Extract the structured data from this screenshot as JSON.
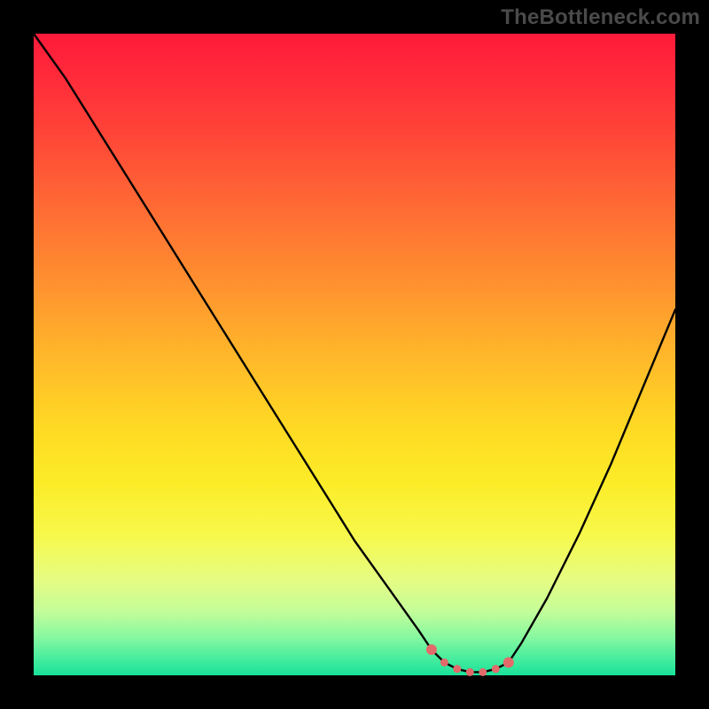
{
  "watermark": "TheBottleneck.com",
  "chart_data": {
    "type": "line",
    "title": "",
    "xlabel": "",
    "ylabel": "",
    "xlim": [
      0,
      100
    ],
    "ylim": [
      0,
      100
    ],
    "grid": false,
    "legend": false,
    "series": [
      {
        "name": "curve",
        "x": [
          0,
          5,
          10,
          15,
          20,
          25,
          30,
          35,
          40,
          45,
          50,
          55,
          60,
          62,
          64,
          66,
          68,
          70,
          72,
          74,
          76,
          80,
          85,
          90,
          95,
          100
        ],
        "y": [
          100,
          93,
          85,
          77,
          69,
          61,
          53,
          45,
          37,
          29,
          21,
          14,
          7,
          4,
          2,
          1,
          0.5,
          0.5,
          1,
          2,
          5,
          12,
          22,
          33,
          45,
          57
        ],
        "color": "#000000"
      },
      {
        "name": "highlight-dots",
        "x": [
          62,
          64,
          66,
          68,
          70,
          72,
          74
        ],
        "y": [
          4,
          2,
          1,
          0.5,
          0.5,
          1,
          2
        ],
        "color": "#e26a6a"
      }
    ]
  },
  "colors": {
    "frame": "#000000",
    "curve": "#000000",
    "dots": "#e26a6a"
  }
}
